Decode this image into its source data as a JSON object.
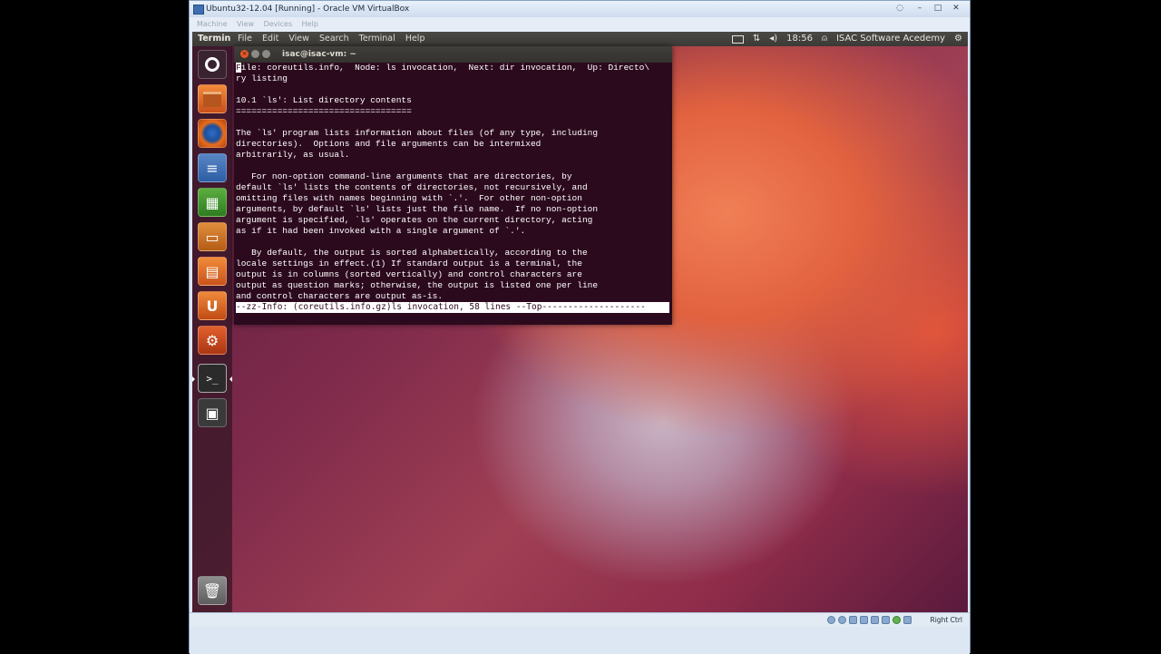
{
  "vbox": {
    "title": "Ubuntu32-12.04 [Running] - Oracle VM VirtualBox",
    "menu": [
      "Machine",
      "View",
      "Devices",
      "Help"
    ],
    "host_key": "Right Ctrl"
  },
  "top_panel": {
    "app_name": "Termin",
    "menus": [
      "File",
      "Edit",
      "View",
      "Search",
      "Terminal",
      "Help"
    ],
    "clock": "18:56",
    "user": "ISAC Software Acedemy"
  },
  "terminal": {
    "title": "isac@isac-vm: ~",
    "first_char": "F",
    "first_line_rest": "ile: coreutils.info,  Node: ls invocation,  Next: dir invocation,  Up: Directo\\",
    "lines": [
      "ry listing",
      "",
      "10.1 `ls': List directory contents",
      "==================================",
      "",
      "The `ls' program lists information about files (of any type, including",
      "directories).  Options and file arguments can be intermixed",
      "arbitrarily, as usual.",
      "",
      "   For non-option command-line arguments that are directories, by",
      "default `ls' lists the contents of directories, not recursively, and",
      "omitting files with names beginning with `.'.  For other non-option",
      "arguments, by default `ls' lists just the file name.  If no non-option",
      "argument is specified, `ls' operates on the current directory, acting",
      "as if it had been invoked with a single argument of `.'.",
      "",
      "   By default, the output is sorted alphabetically, according to the",
      "locale settings in effect.(1) If standard output is a terminal, the",
      "output is in columns (sorted vertically) and control characters are",
      "output as question marks; otherwise, the output is listed one per line",
      "and control characters are output as-is."
    ],
    "status_line": "--zz-Info: (coreutils.info.gz)ls invocation, 58 lines --Top--------------------"
  },
  "launcher": {
    "items": [
      {
        "name": "dash-home-icon"
      },
      {
        "name": "home-folder-icon"
      },
      {
        "name": "firefox-icon"
      },
      {
        "name": "libreoffice-writer-icon"
      },
      {
        "name": "libreoffice-calc-icon"
      },
      {
        "name": "libreoffice-impress-icon"
      },
      {
        "name": "ubuntu-software-center-icon"
      },
      {
        "name": "ubuntu-one-icon"
      },
      {
        "name": "system-settings-icon"
      },
      {
        "name": "terminal-icon"
      },
      {
        "name": "workspace-switcher-icon"
      },
      {
        "name": "trash-icon"
      }
    ],
    "ubuntu_one_glyph": "U",
    "terminal_glyph": ">_"
  }
}
